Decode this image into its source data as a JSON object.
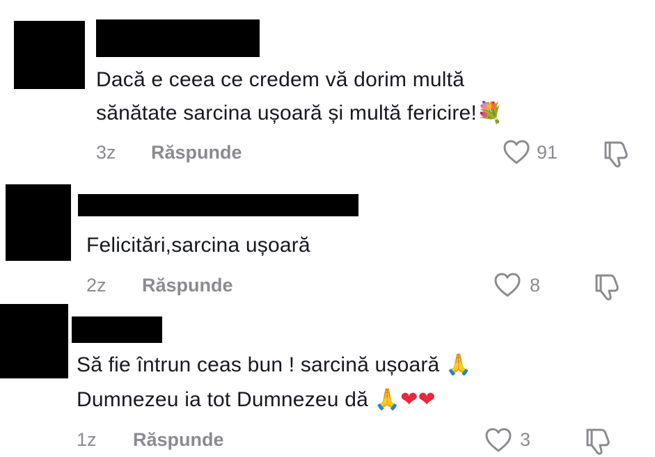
{
  "colors": {
    "text": "#161823",
    "meta": "#8a8b91",
    "redacted": "#000000",
    "heart_red": "#e8283c"
  },
  "comments": [
    {
      "lines": [
        "Dacă e ceea ce credem vă dorim multă",
        "sănătate sarcina ușoară și multă fericire!"
      ],
      "emoji_after_line2": "💐",
      "time": "3z",
      "reply_label": "Răspunde",
      "likes": "91"
    },
    {
      "lines": [
        "Felicitări,sarcina ușoară"
      ],
      "time": "2z",
      "reply_label": "Răspunde",
      "likes": "8"
    },
    {
      "lines": [
        "Să fie întrun ceas bun ! sarcină ușoară",
        "Dumnezeu ia tot Dumnezeu dă"
      ],
      "emoji_after_line1": "🙏",
      "emoji_after_line2_a": "🙏",
      "emoji_after_line2_b": "❤",
      "emoji_after_line2_c": "❤",
      "time": "1z",
      "reply_label": "Răspunde",
      "likes": "3"
    }
  ],
  "icons": {
    "like": "heart-outline-icon",
    "dislike": "thumbs-down-icon",
    "avatar": "redacted-avatar",
    "username": "redacted-username"
  }
}
